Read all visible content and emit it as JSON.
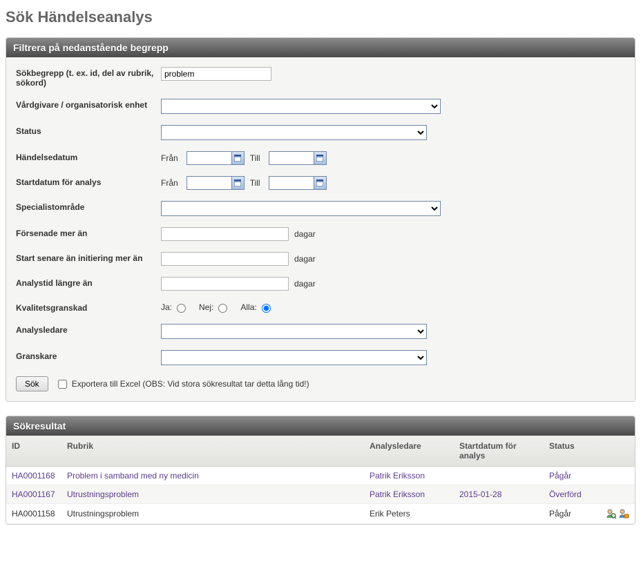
{
  "page_title": "Sök Händelseanalys",
  "filter_panel": {
    "header": "Filtrera på nedanstående begrepp",
    "labels": {
      "sokbegrepp": "Sökbegrepp (t. ex. id, del av rubrik, sökord)",
      "vardgivare": "Vårdgivare / organisatorisk enhet",
      "status": "Status",
      "handelsedatum": "Händelsedatum",
      "startdatum": "Startdatum för analys",
      "specialist": "Specialistområde",
      "forsenade": "Försenade mer än",
      "start_senare": "Start senare än initiering mer än",
      "analystid": "Analystid längre än",
      "kvalitet": "Kvalitetsgranskad",
      "analysledare": "Analysledare",
      "granskare": "Granskare"
    },
    "sublabels": {
      "fran": "Från",
      "till": "Till",
      "dagar": "dagar",
      "ja": "Ja:",
      "nej": "Nej:",
      "alla": "Alla:"
    },
    "values": {
      "sokbegrepp": "problem",
      "vardgivare": "",
      "status": "",
      "handelsedatum_fran": "",
      "handelsedatum_till": "",
      "startdatum_fran": "",
      "startdatum_till": "",
      "specialist": "",
      "forsenade": "",
      "start_senare": "",
      "analystid": "",
      "kvalitet_radio": "alla",
      "analysledare": "",
      "granskare": ""
    },
    "buttons": {
      "sok": "Sök",
      "export_label": "Exportera till Excel (OBS: Vid stora sökresultat tar detta lång tid!)"
    }
  },
  "results_panel": {
    "header": "Sökresultat",
    "columns": {
      "id": "ID",
      "rubrik": "Rubrik",
      "analysledare": "Analysledare",
      "startdatum": "Startdatum för analys",
      "status": "Status"
    },
    "rows": [
      {
        "id": "HA0001168",
        "rubrik": "Problem i samband med ny medicin",
        "analysledare": "Patrik Eriksson",
        "startdatum": "",
        "status": "Pågår",
        "linked": true,
        "icons": []
      },
      {
        "id": "HA0001167",
        "rubrik": "Utrustningsproblem",
        "analysledare": "Patrik Eriksson",
        "startdatum": "2015-01-28",
        "status": "Överförd",
        "linked": true,
        "icons": []
      },
      {
        "id": "HA0001158",
        "rubrik": "Utrustningsproblem",
        "analysledare": "Erik Peters",
        "startdatum": "",
        "status": "Pågår",
        "linked": false,
        "icons": [
          "user-search-icon",
          "user-role-icon"
        ]
      }
    ]
  }
}
